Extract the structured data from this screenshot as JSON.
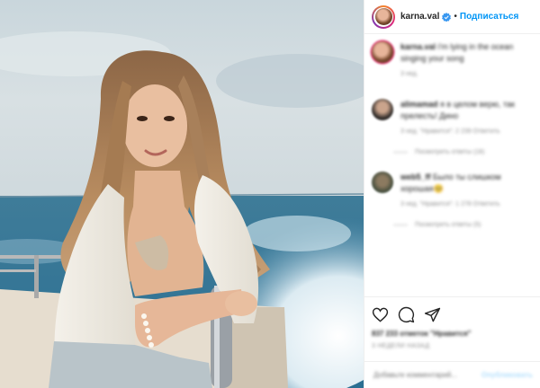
{
  "post": {
    "username": "karna.val",
    "separator": "•",
    "follow_label": "Подписаться",
    "verified_icon": "verified-badge-icon"
  },
  "comments": [
    {
      "author": "karna.val",
      "text": "i'm lying in the ocean singing your song",
      "meta": "3 нед.",
      "replies": ""
    },
    {
      "author": "alimamad",
      "text": "я в целом верю, так прелесть! Дино",
      "meta": "3 нед.  \"Нравится\": 2 239   Ответить",
      "replies": "Посмотреть ответы (18)"
    },
    {
      "author": "web5_ff",
      "text": "Было ты слишком хорошая🥺",
      "meta": "3 нед.  \"Нравится\": 1 278   Ответить",
      "replies": "Посмотреть ответы (5)"
    }
  ],
  "actions": {
    "like_icon": "heart-icon",
    "comment_icon": "comment-icon",
    "share_icon": "share-icon",
    "likes_text": "837 233 отметок \"Нравится\"",
    "timestamp": "3 НЕДЕЛИ НАЗАД"
  },
  "add_comment": {
    "placeholder": "Добавьте комментарий...",
    "post_label": "Опубликовать"
  },
  "colors": {
    "accent": "#0095f6",
    "text": "#262626",
    "muted": "#8e8e8e",
    "border": "#efefef"
  }
}
